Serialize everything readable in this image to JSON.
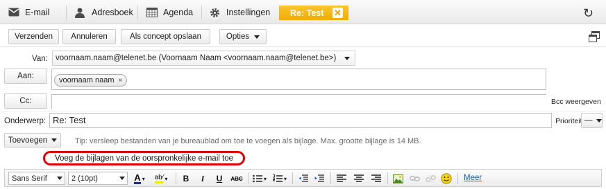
{
  "nav": {
    "email": "E-mail",
    "addressbook": "Adresboek",
    "agenda": "Agenda",
    "settings": "Instellingen",
    "active_tab": "Re: Test",
    "active_tab_close": "✕",
    "refresh": "↻"
  },
  "toolbar": {
    "send": "Verzenden",
    "cancel": "Annuleren",
    "draft": "Als concept opslaan",
    "options": "Opties"
  },
  "form": {
    "from_label": "Van:",
    "from_value": "voornaam.naam@telenet.be (Voornaam Naam <voornaam.naam@telenet.be>)",
    "to_button": "Aan:",
    "to_token": "voornaam naam",
    "to_token_remove": "×",
    "cc_button": "Cc:",
    "bcc_link": "Bcc weergeven",
    "subject_label": "Onderwerp:",
    "subject_value": "Re: Test",
    "priority_label": "Prioriteit:",
    "priority_value": "—",
    "add_button": "Toevoegen",
    "tip": "Tip: versleep bestanden van je bureaublad om toe te voegen als bijlage. Max. grootte bijlage is 14 MB.",
    "attach_original": "Voeg de bijlagen van de oorspronkelijke e-mail toe"
  },
  "editor": {
    "font_family": "Sans Serif",
    "font_size": "2 (10pt)",
    "bold": "B",
    "italic": "I",
    "underline": "U",
    "strike": "ABC",
    "more": "Meer"
  },
  "colors": {
    "accent": "#f0ac00",
    "highlight_ring": "#e00000",
    "link": "#1a5fb4"
  }
}
